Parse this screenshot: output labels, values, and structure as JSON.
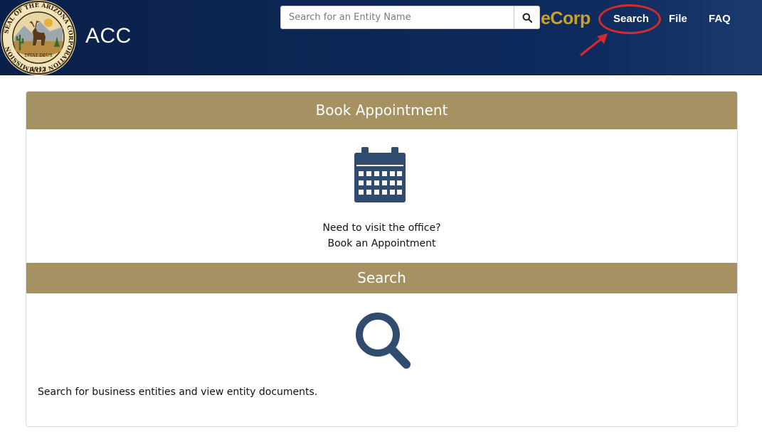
{
  "header": {
    "app_title": "ACC",
    "search": {
      "placeholder": "Search for an Entity Name",
      "value": ""
    },
    "brand": "eCorp",
    "nav": {
      "search_label": "Search",
      "file_label": "File",
      "faq_label": "FAQ"
    },
    "seal": {
      "ring_text": "SEAL OF THE ARIZONA CORPORATION COMMISSION",
      "motto": "DITAT DEUS",
      "year": "1912"
    }
  },
  "sections": {
    "book": {
      "title": "Book Appointment",
      "line1": "Need to visit the office?",
      "line2": "Book an Appointment"
    },
    "search": {
      "title": "Search",
      "description": "Search for business entities and view entity documents."
    }
  },
  "colors": {
    "header_bg": "#0d2655",
    "brand_gold": "#c9a227",
    "section_header": "#a69162",
    "icon_blue": "#2f4b6e",
    "annotation_red": "#d42a2a"
  },
  "icons": {
    "search_button": "magnifier-icon",
    "book_section": "calendar-icon",
    "search_section": "magnifier-icon"
  }
}
